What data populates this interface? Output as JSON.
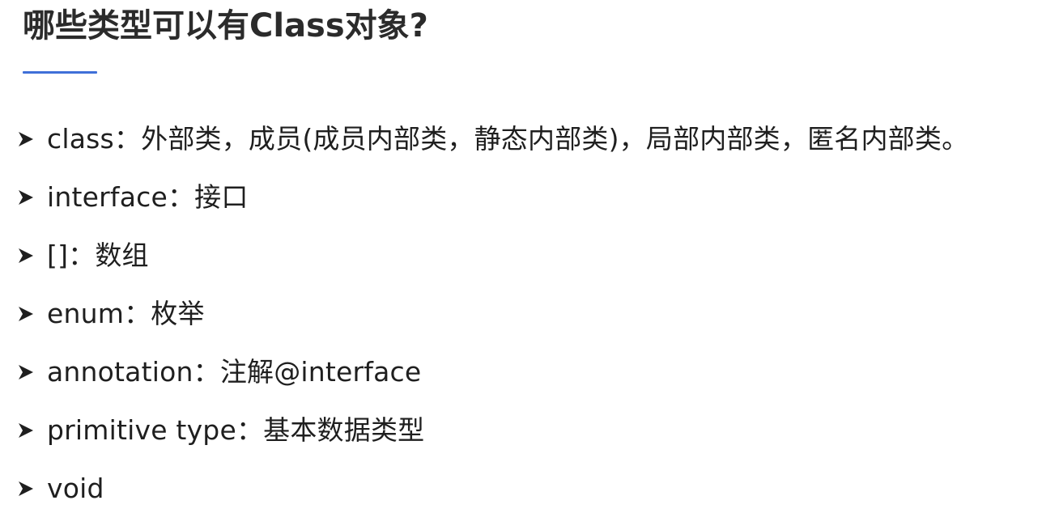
{
  "slide": {
    "title": "哪些类型可以有Class对象?",
    "accent_color": "#3f6fd8",
    "bullet_icon": "arrowhead-bullet-icon",
    "bullets": [
      {
        "text": "class：外部类，成员(成员内部类，静态内部类)，局部内部类，匿名内部类。"
      },
      {
        "text": "interface：接口"
      },
      {
        "text": "[]：数组"
      },
      {
        "text": "enum：枚举"
      },
      {
        "text": "annotation：注解@interface"
      },
      {
        "text": "primitive type：基本数据类型"
      },
      {
        "text": "void"
      }
    ]
  }
}
